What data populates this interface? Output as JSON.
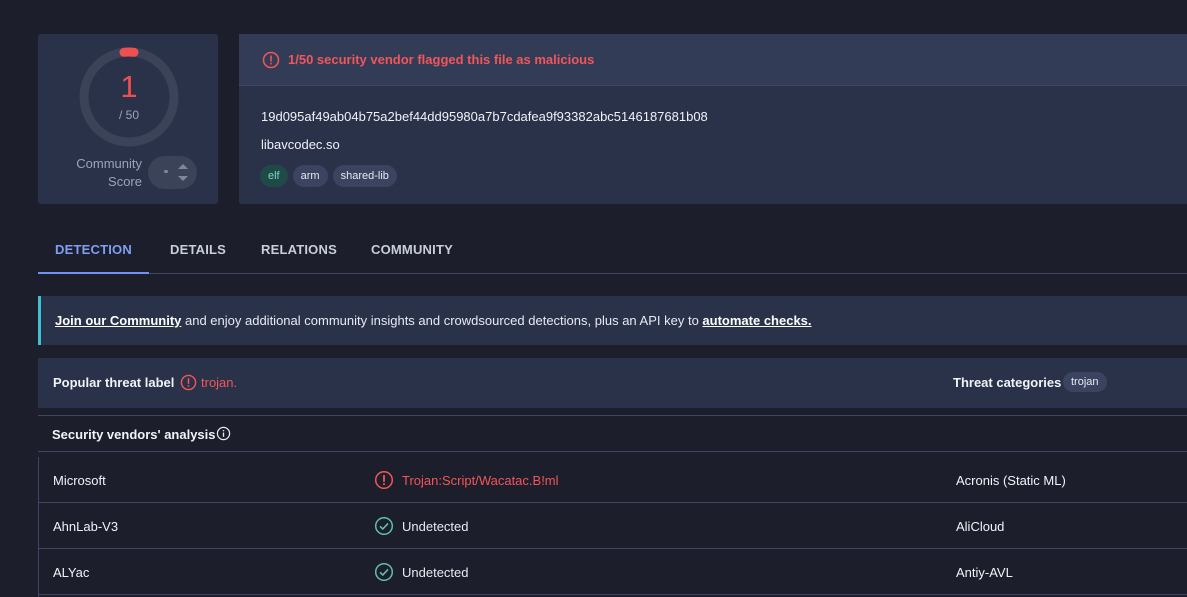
{
  "score": {
    "detections": "1",
    "total": "/ 50",
    "community_label": "Community Score",
    "colors": {
      "detected": "#ef4f51",
      "ring": "#3a4358"
    }
  },
  "file": {
    "alert": "1/50 security vendor flagged this file as malicious",
    "hash": "19d095af49ab04b75a2bef44dd95980a7b7cdafea9f93382abc5146187681b08",
    "name": "libavcodec.so",
    "tags": [
      "elf",
      "arm",
      "shared-lib"
    ]
  },
  "tabs": [
    "DETECTION",
    "DETAILS",
    "RELATIONS",
    "COMMUNITY"
  ],
  "banner": {
    "link1": "Join our Community",
    "middle": " and enjoy additional community insights and crowdsourced detections, plus an API key to ",
    "link2": "automate checks."
  },
  "threat": {
    "label": "Popular threat label",
    "value": "trojan.",
    "categories_label": "Threat categories",
    "category": "trojan"
  },
  "vendors": {
    "title": "Security vendors' analysis",
    "rows": [
      {
        "name": "Microsoft",
        "result": "Trojan:Script/Wacatac.B!ml",
        "status": "malicious",
        "name2": "Acronis (Static ML)"
      },
      {
        "name": "AhnLab-V3",
        "result": "Undetected",
        "status": "undetected",
        "name2": "AliCloud"
      },
      {
        "name": "ALYac",
        "result": "Undetected",
        "status": "undetected",
        "name2": "Antiy-AVL"
      }
    ]
  },
  "icons": {
    "alert": "alert-circle-icon",
    "check": "check-circle-icon",
    "info": "info-circle-icon"
  }
}
